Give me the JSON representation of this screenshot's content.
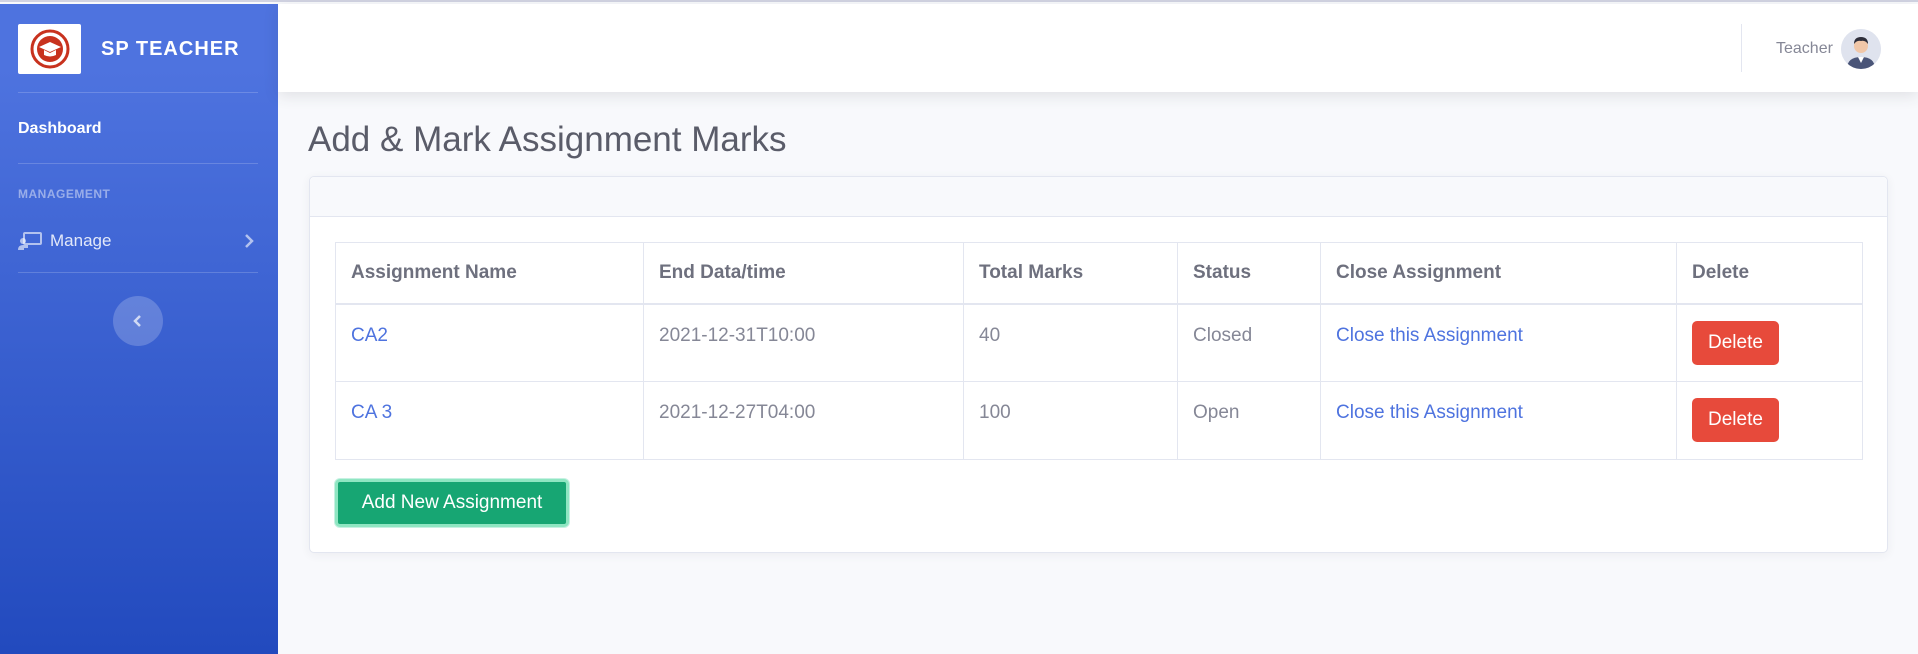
{
  "brand": {
    "name": "SP TEACHER",
    "logo_icon": "graduation-cap-icon"
  },
  "sidebar": {
    "dashboard_label": "Dashboard",
    "heading": "MANAGEMENT",
    "manage_label": "Manage"
  },
  "topbar": {
    "user_name": "Teacher"
  },
  "page": {
    "title": "Add & Mark Assignment Marks"
  },
  "table": {
    "headers": [
      "Assignment Name",
      "End Data/time",
      "Total Marks",
      "Status",
      "Close Assignment",
      "Delete"
    ],
    "rows": [
      {
        "name": "CA2",
        "end": "2021-12-31T10:00",
        "marks": "40",
        "status": "Closed",
        "close": "Close this Assignment",
        "delete": "Delete"
      },
      {
        "name": "CA 3",
        "end": "2021-12-27T04:00",
        "marks": "100",
        "status": "Open",
        "close": "Close this Assignment",
        "delete": "Delete"
      }
    ]
  },
  "actions": {
    "add_label": "Add New Assignment"
  },
  "colors": {
    "primary": "#4e73df",
    "danger": "#e74a3b",
    "success": "#17a673"
  }
}
